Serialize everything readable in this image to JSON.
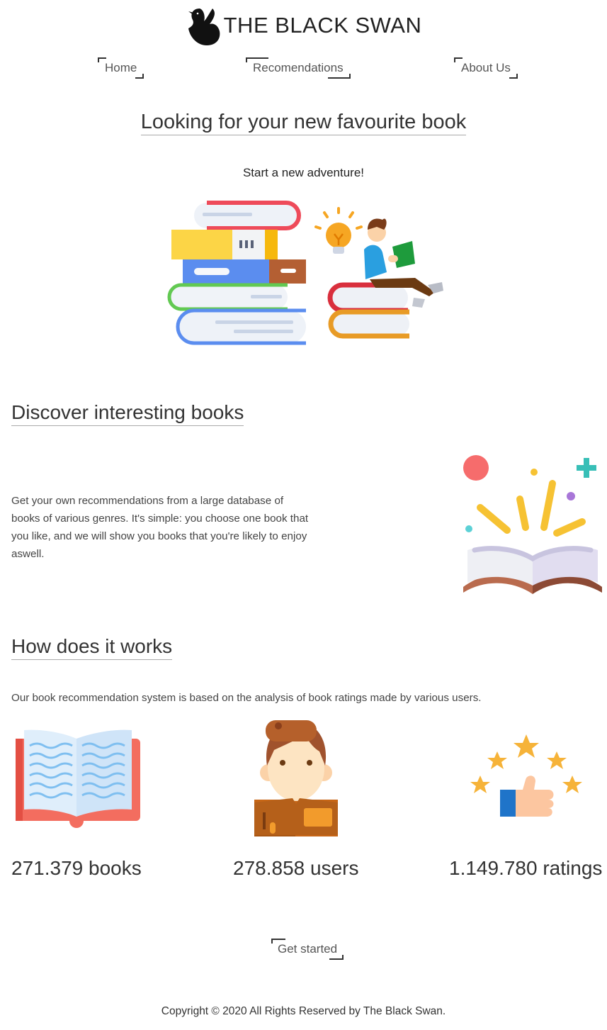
{
  "header": {
    "title": "THE BLACK SWAN",
    "logo_icon": "black-swan-icon",
    "nav": [
      {
        "label": "Home"
      },
      {
        "label": "Recomendations"
      },
      {
        "label": "About Us"
      }
    ]
  },
  "hero": {
    "title": "Looking for your new favourite book",
    "subtitle": "Start a new adventure!",
    "illustration": "books-stack-reader-illustration"
  },
  "discover": {
    "title": "Discover interesting books",
    "text": "Get your own recommendations from a large database of books of various genres. It's simple: you choose one book that you like, and we will show you books that you're likely to enjoy aswell.",
    "illustration": "open-book-sparkles-illustration"
  },
  "how": {
    "title": "How does it works",
    "text": "Our book recommendation system is based on the analysis of book ratings made by various users.",
    "stats": [
      {
        "label": "271.379 books",
        "icon": "open-book-icon"
      },
      {
        "label": "278.858 users",
        "icon": "reader-icon"
      },
      {
        "label": "1.149.780 ratings",
        "icon": "thumbs-up-stars-icon"
      }
    ]
  },
  "cta": {
    "label": "Get started"
  },
  "footer": {
    "text": "Copyright © 2020 All Rights Reserved by The Black Swan."
  },
  "colors": {
    "text": "#333333",
    "accent_red": "#f05a5b",
    "accent_yellow": "#f6c233",
    "accent_blue": "#5b8def"
  }
}
